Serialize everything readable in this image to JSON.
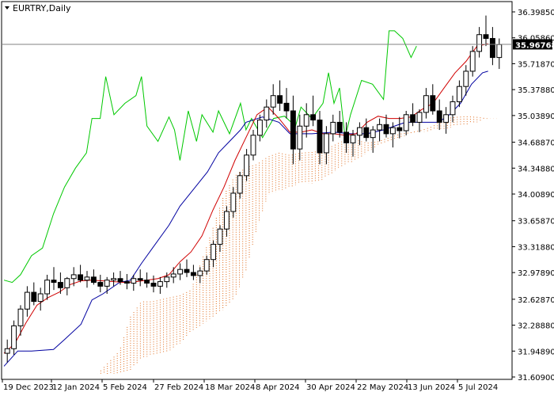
{
  "chart_data": {
    "type": "candlestick",
    "symbol_label": "EURTRY,Daily",
    "current_price": "35.96768",
    "price_ticks": [
      "36.39850",
      "36.05860",
      "35.71870",
      "35.37880",
      "35.03890",
      "34.68870",
      "34.34880",
      "34.00890",
      "33.65870",
      "33.31880",
      "32.97890",
      "32.62870",
      "32.28880",
      "31.94890",
      "31.60900"
    ],
    "date_ticks": [
      "19 Dec 2023",
      "12 Jan 2024",
      "5 Feb 2024",
      "27 Feb 2024",
      "18 Mar 2024",
      "8 Apr 2024",
      "30 Apr 2024",
      "22 May 2024",
      "13 Jun 2024",
      "5 Jul 2024"
    ],
    "ylim": [
      31.609,
      36.3985
    ],
    "colors": {
      "candles": "#000000",
      "tenkan": "#d00000",
      "kijun": "#0000a0",
      "chikou": "#00c800",
      "cloud": "#e06a1a",
      "price_line": "#808080",
      "price_label_bg": "#000000",
      "price_label_text": "#ffffff"
    },
    "series": [
      {
        "key": "tenkan",
        "values": [
          [
            0,
            31.92
          ],
          [
            4,
            32.05
          ],
          [
            8,
            32.32
          ],
          [
            12,
            32.55
          ],
          [
            16,
            32.65
          ],
          [
            20,
            32.72
          ],
          [
            24,
            32.82
          ],
          [
            28,
            32.87
          ],
          [
            32,
            32.88
          ],
          [
            36,
            32.87
          ],
          [
            40,
            32.86
          ],
          [
            44,
            32.85
          ],
          [
            48,
            32.86
          ],
          [
            52,
            32.88
          ],
          [
            56,
            32.9
          ],
          [
            60,
            32.95
          ],
          [
            64,
            33.12
          ],
          [
            68,
            33.25
          ],
          [
            72,
            33.46
          ],
          [
            76,
            33.8
          ],
          [
            80,
            34.1
          ],
          [
            84,
            34.45
          ],
          [
            88,
            34.75
          ],
          [
            92,
            35.05
          ],
          [
            96,
            35.15
          ],
          [
            100,
            35.0
          ],
          [
            104,
            34.82
          ],
          [
            108,
            34.82
          ],
          [
            112,
            34.85
          ],
          [
            116,
            34.8
          ],
          [
            120,
            34.8
          ],
          [
            124,
            34.78
          ],
          [
            128,
            34.8
          ],
          [
            132,
            34.95
          ],
          [
            136,
            35.03
          ],
          [
            140,
            35.0
          ],
          [
            144,
            35.0
          ],
          [
            148,
            35.02
          ],
          [
            152,
            35.12
          ],
          [
            156,
            35.2
          ],
          [
            160,
            35.4
          ],
          [
            164,
            35.6
          ],
          [
            168,
            35.75
          ],
          [
            172,
            35.95
          ],
          [
            176,
            35.98
          ]
        ]
      },
      {
        "key": "kijun",
        "values": [
          [
            0,
            31.75
          ],
          [
            5,
            31.95
          ],
          [
            10,
            31.95
          ],
          [
            18,
            31.97
          ],
          [
            22,
            32.1
          ],
          [
            28,
            32.3
          ],
          [
            32,
            32.62
          ],
          [
            36,
            32.7
          ],
          [
            42,
            32.85
          ],
          [
            46,
            32.88
          ],
          [
            50,
            33.1
          ],
          [
            54,
            33.3
          ],
          [
            60,
            33.6
          ],
          [
            64,
            33.85
          ],
          [
            70,
            34.12
          ],
          [
            74,
            34.3
          ],
          [
            78,
            34.55
          ],
          [
            82,
            34.7
          ],
          [
            86,
            34.85
          ],
          [
            88,
            34.95
          ],
          [
            94,
            35.02
          ],
          [
            100,
            34.95
          ],
          [
            104,
            34.8
          ],
          [
            112,
            34.8
          ],
          [
            120,
            34.82
          ],
          [
            126,
            34.8
          ],
          [
            132,
            34.8
          ],
          [
            138,
            34.85
          ],
          [
            146,
            34.95
          ],
          [
            152,
            34.95
          ],
          [
            158,
            34.95
          ],
          [
            162,
            35.05
          ],
          [
            166,
            35.2
          ],
          [
            170,
            35.45
          ],
          [
            174,
            35.6
          ],
          [
            176,
            35.62
          ]
        ]
      },
      {
        "key": "chikou",
        "values": [
          [
            0,
            32.88
          ],
          [
            3,
            32.85
          ],
          [
            6,
            32.95
          ],
          [
            10,
            33.2
          ],
          [
            14,
            33.3
          ],
          [
            18,
            33.75
          ],
          [
            22,
            34.1
          ],
          [
            26,
            34.35
          ],
          [
            30,
            34.55
          ],
          [
            32,
            35.0
          ],
          [
            35,
            35.0
          ],
          [
            37,
            35.55
          ],
          [
            40,
            35.05
          ],
          [
            44,
            35.2
          ],
          [
            48,
            35.3
          ],
          [
            50,
            35.55
          ],
          [
            52,
            34.9
          ],
          [
            56,
            34.7
          ],
          [
            60,
            35.02
          ],
          [
            62,
            34.85
          ],
          [
            64,
            34.45
          ],
          [
            67,
            35.1
          ],
          [
            70,
            34.7
          ],
          [
            72,
            35.05
          ],
          [
            76,
            34.82
          ],
          [
            78,
            35.1
          ],
          [
            82,
            34.8
          ],
          [
            86,
            35.2
          ],
          [
            88,
            34.85
          ],
          [
            90,
            35.0
          ],
          [
            94,
            34.75
          ],
          [
            98,
            35.0
          ],
          [
            102,
            35.03
          ],
          [
            106,
            34.9
          ],
          [
            108,
            35.15
          ],
          [
            112,
            35.0
          ],
          [
            116,
            35.2
          ],
          [
            118,
            35.6
          ],
          [
            120,
            35.2
          ],
          [
            122,
            35.4
          ],
          [
            124,
            34.75
          ],
          [
            126,
            35.05
          ],
          [
            130,
            35.5
          ],
          [
            134,
            35.45
          ],
          [
            138,
            35.25
          ],
          [
            140,
            36.15
          ],
          [
            142,
            36.15
          ],
          [
            145,
            36.05
          ],
          [
            148,
            35.8
          ],
          [
            150,
            35.95
          ]
        ]
      },
      {
        "key": "span_a",
        "values": [
          [
            34,
            31.65
          ],
          [
            38,
            31.8
          ],
          [
            42,
            31.95
          ],
          [
            46,
            32.4
          ],
          [
            50,
            32.6
          ],
          [
            54,
            32.6
          ],
          [
            60,
            32.65
          ],
          [
            64,
            32.68
          ],
          [
            68,
            32.75
          ],
          [
            74,
            33.35
          ],
          [
            80,
            34.0
          ],
          [
            84,
            34.25
          ],
          [
            88,
            34.36
          ],
          [
            92,
            34.4
          ],
          [
            96,
            34.5
          ],
          [
            100,
            34.55
          ],
          [
            104,
            34.52
          ],
          [
            108,
            34.55
          ],
          [
            112,
            34.56
          ],
          [
            116,
            34.58
          ],
          [
            120,
            34.65
          ],
          [
            124,
            34.72
          ],
          [
            128,
            34.72
          ],
          [
            132,
            34.68
          ],
          [
            136,
            34.7
          ],
          [
            140,
            34.75
          ],
          [
            144,
            34.8
          ],
          [
            148,
            34.82
          ],
          [
            152,
            34.85
          ],
          [
            156,
            34.9
          ],
          [
            160,
            35.0
          ],
          [
            164,
            35.02
          ],
          [
            168,
            35.03
          ],
          [
            172,
            35.02
          ],
          [
            176,
            35.0
          ],
          [
            180,
            35.0
          ]
        ]
      },
      {
        "key": "span_b",
        "values": [
          [
            34,
            31.65
          ],
          [
            38,
            31.65
          ],
          [
            42,
            31.65
          ],
          [
            46,
            31.7
          ],
          [
            50,
            31.85
          ],
          [
            54,
            31.9
          ],
          [
            60,
            31.95
          ],
          [
            64,
            32.05
          ],
          [
            68,
            32.2
          ],
          [
            72,
            32.3
          ],
          [
            76,
            32.4
          ],
          [
            80,
            32.5
          ],
          [
            84,
            32.65
          ],
          [
            88,
            33.0
          ],
          [
            92,
            33.55
          ],
          [
            96,
            34.0
          ],
          [
            100,
            34.05
          ],
          [
            104,
            34.1
          ],
          [
            108,
            34.15
          ],
          [
            112,
            34.15
          ],
          [
            116,
            34.2
          ],
          [
            120,
            34.3
          ],
          [
            124,
            34.4
          ],
          [
            128,
            34.45
          ],
          [
            132,
            34.55
          ],
          [
            136,
            34.65
          ],
          [
            140,
            34.7
          ],
          [
            144,
            34.75
          ],
          [
            148,
            34.8
          ],
          [
            152,
            34.82
          ],
          [
            156,
            34.85
          ],
          [
            160,
            34.85
          ],
          [
            164,
            34.9
          ],
          [
            168,
            34.92
          ],
          [
            172,
            34.95
          ],
          [
            176,
            35.0
          ],
          [
            180,
            35.0
          ]
        ]
      }
    ],
    "candles": [
      [
        31.92,
        32.1,
        31.8,
        31.98
      ],
      [
        31.98,
        32.35,
        31.9,
        32.28
      ],
      [
        32.28,
        32.55,
        32.15,
        32.5
      ],
      [
        32.5,
        32.8,
        32.4,
        32.72
      ],
      [
        32.72,
        32.85,
        32.55,
        32.6
      ],
      [
        32.6,
        32.78,
        32.48,
        32.7
      ],
      [
        32.7,
        32.95,
        32.62,
        32.88
      ],
      [
        32.88,
        33.05,
        32.75,
        32.85
      ],
      [
        32.85,
        32.98,
        32.7,
        32.78
      ],
      [
        32.78,
        32.92,
        32.68,
        32.9
      ],
      [
        32.9,
        33.05,
        32.8,
        32.95
      ],
      [
        32.95,
        33.08,
        32.85,
        32.88
      ],
      [
        32.88,
        33.0,
        32.78,
        32.92
      ],
      [
        32.92,
        33.02,
        32.82,
        32.85
      ],
      [
        32.85,
        32.95,
        32.72,
        32.8
      ],
      [
        32.8,
        32.92,
        32.7,
        32.88
      ],
      [
        32.88,
        32.98,
        32.8,
        32.9
      ],
      [
        32.9,
        33.0,
        32.82,
        32.86
      ],
      [
        32.86,
        32.96,
        32.76,
        32.84
      ],
      [
        32.84,
        32.95,
        32.74,
        32.9
      ],
      [
        32.9,
        33.02,
        32.8,
        32.88
      ],
      [
        32.88,
        32.98,
        32.78,
        32.84
      ],
      [
        32.84,
        32.94,
        32.72,
        32.8
      ],
      [
        32.8,
        32.92,
        32.7,
        32.86
      ],
      [
        32.86,
        32.98,
        32.78,
        32.92
      ],
      [
        32.92,
        33.05,
        32.84,
        32.96
      ],
      [
        32.96,
        33.1,
        32.88,
        33.02
      ],
      [
        33.02,
        33.15,
        32.92,
        32.98
      ],
      [
        32.98,
        33.08,
        32.88,
        32.94
      ],
      [
        32.94,
        33.05,
        32.84,
        33.0
      ],
      [
        33.0,
        33.2,
        32.95,
        33.15
      ],
      [
        33.15,
        33.4,
        33.05,
        33.35
      ],
      [
        33.35,
        33.6,
        33.25,
        33.55
      ],
      [
        33.55,
        33.85,
        33.45,
        33.78
      ],
      [
        33.78,
        34.1,
        33.7,
        34.02
      ],
      [
        34.02,
        34.3,
        33.95,
        34.25
      ],
      [
        34.25,
        34.6,
        34.18,
        34.52
      ],
      [
        34.52,
        34.85,
        34.45,
        34.78
      ],
      [
        34.78,
        35.05,
        34.7,
        34.98
      ],
      [
        34.98,
        35.25,
        34.88,
        35.15
      ],
      [
        35.15,
        35.45,
        35.05,
        35.3
      ],
      [
        35.3,
        35.5,
        35.1,
        35.2
      ],
      [
        35.2,
        35.4,
        35.0,
        35.1
      ],
      [
        35.1,
        35.3,
        34.4,
        34.6
      ],
      [
        34.6,
        35.05,
        34.45,
        34.9
      ],
      [
        34.9,
        35.2,
        34.75,
        35.05
      ],
      [
        35.05,
        35.3,
        34.9,
        34.98
      ],
      [
        34.98,
        35.1,
        34.4,
        34.55
      ],
      [
        34.55,
        34.9,
        34.4,
        34.8
      ],
      [
        34.8,
        35.05,
        34.7,
        34.95
      ],
      [
        34.95,
        35.1,
        34.75,
        34.82
      ],
      [
        34.82,
        34.95,
        34.55,
        34.68
      ],
      [
        34.68,
        34.85,
        34.5,
        34.78
      ],
      [
        34.78,
        34.95,
        34.65,
        34.88
      ],
      [
        34.88,
        35.0,
        34.7,
        34.75
      ],
      [
        34.75,
        34.9,
        34.55,
        34.85
      ],
      [
        34.85,
        35.0,
        34.7,
        34.92
      ],
      [
        34.92,
        35.05,
        34.75,
        34.8
      ],
      [
        34.8,
        34.95,
        34.62,
        34.88
      ],
      [
        34.88,
        35.02,
        34.74,
        34.84
      ],
      [
        34.84,
        35.1,
        34.78,
        35.05
      ],
      [
        35.05,
        35.2,
        34.9,
        34.95
      ],
      [
        34.95,
        35.12,
        34.82,
        35.08
      ],
      [
        35.08,
        35.4,
        35.0,
        35.3
      ],
      [
        35.3,
        35.45,
        35.05,
        35.1
      ],
      [
        35.1,
        35.25,
        34.85,
        34.95
      ],
      [
        34.95,
        35.15,
        34.8,
        35.05
      ],
      [
        35.05,
        35.3,
        34.95,
        35.22
      ],
      [
        35.22,
        35.5,
        35.15,
        35.42
      ],
      [
        35.42,
        35.7,
        35.3,
        35.62
      ],
      [
        35.62,
        35.95,
        35.55,
        35.88
      ],
      [
        35.88,
        36.2,
        35.8,
        36.1
      ],
      [
        36.1,
        36.35,
        35.95,
        36.05
      ],
      [
        36.05,
        36.2,
        35.7,
        35.8
      ],
      [
        35.8,
        36.05,
        35.65,
        35.97
      ]
    ],
    "candle_start_index": 0
  }
}
